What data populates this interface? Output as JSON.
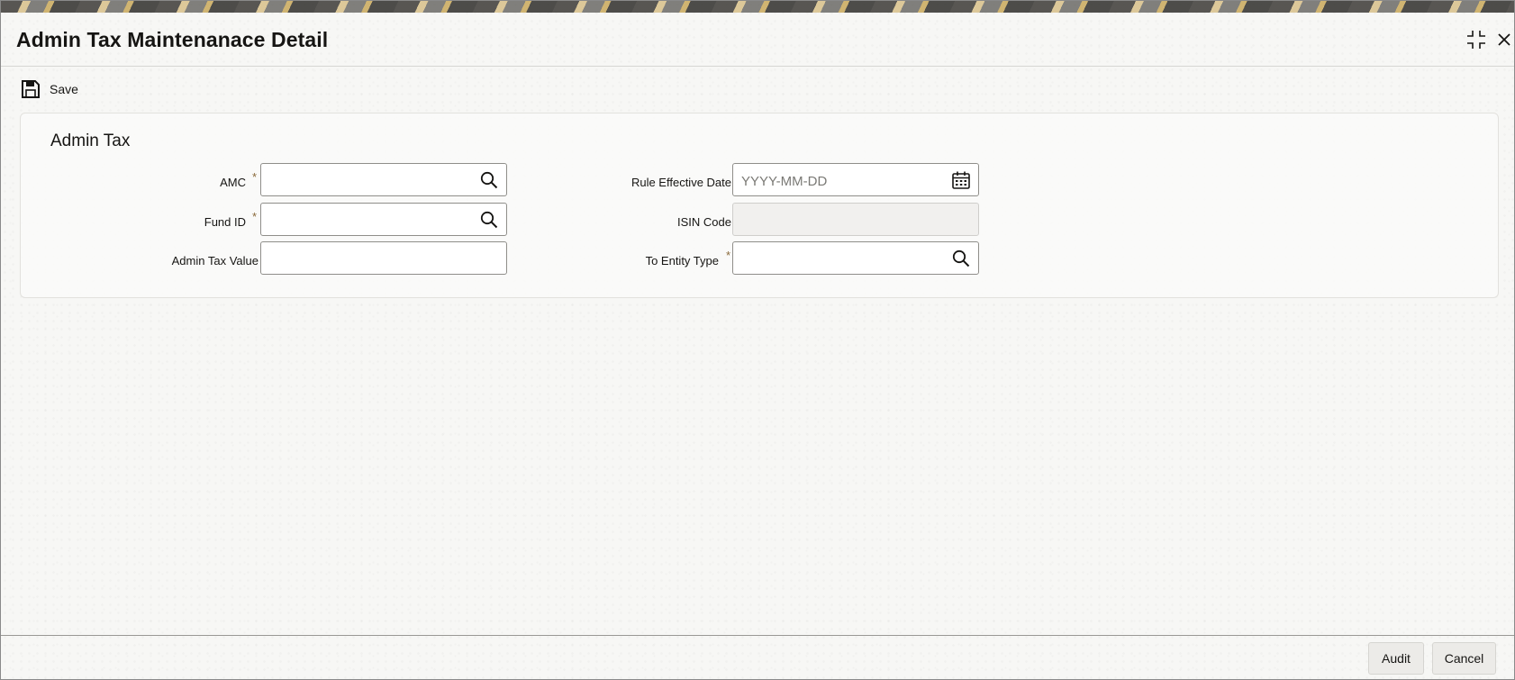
{
  "window": {
    "title": "Admin Tax Maintenanace Detail",
    "maximize_icon": "collapse-arrows-icon",
    "close_icon": "close-icon"
  },
  "toolbar": {
    "save_label": "Save",
    "save_icon": "floppy-disk-icon"
  },
  "section": {
    "title": "Admin Tax",
    "fields": {
      "amc": {
        "label": "AMC",
        "required": true,
        "value": "",
        "icon": "search-icon"
      },
      "fund_id": {
        "label": "Fund ID",
        "required": true,
        "value": "",
        "icon": "search-icon"
      },
      "admin_tax_value": {
        "label": "Admin Tax Value",
        "required": false,
        "value": ""
      },
      "rule_effective_date": {
        "label": "Rule Effective Date",
        "required": false,
        "value": "",
        "placeholder": "YYYY-MM-DD",
        "icon": "calendar-icon"
      },
      "isin_code": {
        "label": "ISIN Code",
        "required": false,
        "value": "",
        "readonly": true
      },
      "to_entity_type": {
        "label": "To Entity Type",
        "required": true,
        "value": "",
        "icon": "search-icon"
      }
    },
    "required_marker": "*"
  },
  "footer": {
    "audit_label": "Audit",
    "cancel_label": "Cancel"
  },
  "colors": {
    "text": "#161513",
    "required_marker": "#8a6a3b",
    "input_border": "#8f8e8a",
    "button_bg": "#ecebe8"
  }
}
